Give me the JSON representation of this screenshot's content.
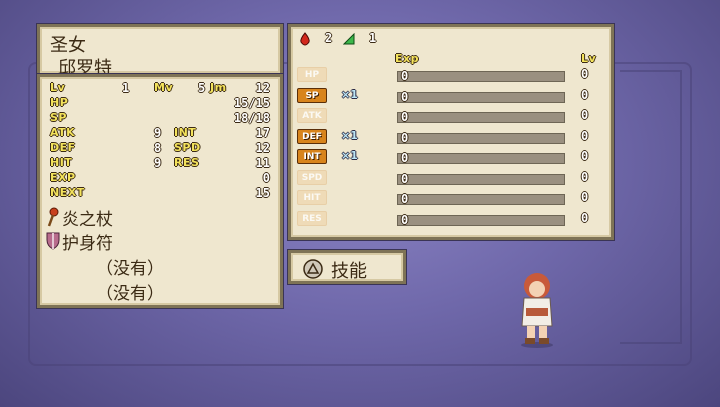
{
  "character": {
    "class": "圣女",
    "name": "邱罗特"
  },
  "stats": {
    "lv": {
      "label": "Lv",
      "value": "1"
    },
    "mv": {
      "label": "Mv",
      "value": "5"
    },
    "jm": {
      "label": "Jm",
      "value": "12"
    },
    "hp": {
      "label": "HP",
      "value": "15/15"
    },
    "sp": {
      "label": "SP",
      "value": "18/18"
    },
    "atk": {
      "label": "ATK",
      "value": "9"
    },
    "int": {
      "label": "INT",
      "value": "17"
    },
    "def": {
      "label": "DEF",
      "value": "8"
    },
    "spd": {
      "label": "SPD",
      "value": "12"
    },
    "hit": {
      "label": "HIT",
      "value": "9"
    },
    "res": {
      "label": "RES",
      "value": "11"
    },
    "exp": {
      "label": "EXP",
      "value": "0"
    },
    "next": {
      "label": "NEXT",
      "value": "15"
    }
  },
  "equipment": [
    {
      "icon": "staff-icon",
      "name": "炎之杖"
    },
    {
      "icon": "shield-icon",
      "name": "护身符"
    },
    {
      "icon": "",
      "name": "（没有）"
    },
    {
      "icon": "",
      "name": "（没有）"
    }
  ],
  "resources": {
    "red_count": "2",
    "green_count": "1"
  },
  "growth_headers": {
    "exp": "Exp",
    "lv": "Lv"
  },
  "growth": [
    {
      "stat": "HP",
      "active": false,
      "mult": "",
      "exp": "0",
      "lv": "0"
    },
    {
      "stat": "SP",
      "active": true,
      "mult": "×1",
      "exp": "0",
      "lv": "0"
    },
    {
      "stat": "ATK",
      "active": false,
      "mult": "",
      "exp": "0",
      "lv": "0"
    },
    {
      "stat": "DEF",
      "active": true,
      "mult": "×1",
      "exp": "0",
      "lv": "0"
    },
    {
      "stat": "INT",
      "active": true,
      "mult": "×1",
      "exp": "0",
      "lv": "0"
    },
    {
      "stat": "SPD",
      "active": false,
      "mult": "",
      "exp": "0",
      "lv": "0"
    },
    {
      "stat": "HIT",
      "active": false,
      "mult": "",
      "exp": "0",
      "lv": "0"
    },
    {
      "stat": "RES",
      "active": false,
      "mult": "",
      "exp": "0",
      "lv": "0"
    }
  ],
  "skill_button": {
    "label": "技能",
    "icon": "triangle-button-icon"
  },
  "colors": {
    "panel": "#efe7cf",
    "border": "#7e7356",
    "badge_active": "#d8841c",
    "background": "#6f68aa"
  }
}
